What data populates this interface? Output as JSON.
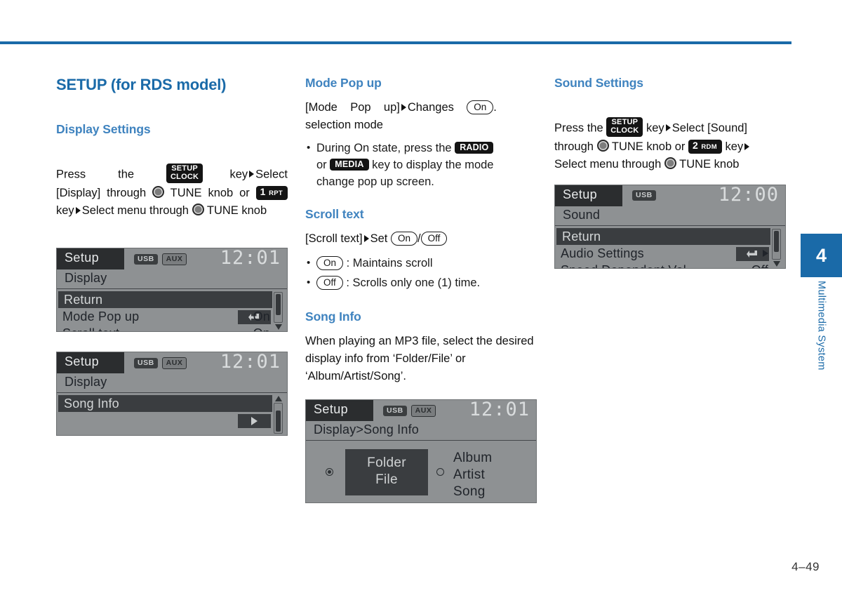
{
  "page": {
    "number": "4–49",
    "chapter_number": "4",
    "chapter_label": "Multimedia System",
    "accent_color": "#1a6aa8",
    "heading_color": "#3f83bf"
  },
  "col1": {
    "main_title": "SETUP (for RDS model)",
    "section_title": "Display Settings",
    "instruction": {
      "t1": "Press",
      "t2": "the",
      "key_setup_line1": "SETUP",
      "key_setup_line2": "CLOCK",
      "t3": "key",
      "t4": "Select",
      "t5": "[Display]",
      "t6": "through",
      "t7": "TUNE",
      "t8": "knob",
      "t9": "or",
      "key_num": "1",
      "key_num_sub": "RPT",
      "t10": "key",
      "t11": "Select",
      "t12": "menu",
      "t13": "through",
      "t14": "TUNE knob"
    },
    "lcd1": {
      "title": "Setup",
      "badges": [
        "USB",
        "AUX"
      ],
      "clock": "12:01",
      "path": "Display",
      "rows": [
        {
          "label": "Return",
          "value": "",
          "selected": true,
          "icon": "return-arrow"
        },
        {
          "label": "Mode Pop up",
          "value": "On",
          "selected": false,
          "icon": ""
        },
        {
          "label": "Scroll text",
          "value": "On",
          "selected": false,
          "icon": ""
        }
      ]
    },
    "lcd2": {
      "title": "Setup",
      "badges": [
        "USB",
        "AUX"
      ],
      "clock": "12:01",
      "path": "Display",
      "rows": [
        {
          "label": "Song Info",
          "value": "",
          "selected": true,
          "icon": "chevron-right"
        }
      ]
    }
  },
  "col2": {
    "mode_popup": {
      "title": "Mode Pop up",
      "line1_a": "[Mode",
      "line1_b": "Pop",
      "line1_c": "up]",
      "line1_d": "Changes",
      "pill_on": "On",
      "line1_e": ".",
      "line2": "selection mode",
      "bullet1_a": "During On state, press the",
      "key_radio": "RADIO",
      "bullet1_b": "or",
      "key_media": "MEDIA",
      "bullet1_c": "key to display the mode",
      "bullet1_d": "change pop up screen."
    },
    "scroll_text": {
      "title": "Scroll text",
      "lead_a": "[Scroll text]",
      "lead_b": "Set",
      "pill_on": "On",
      "slash": "/",
      "pill_off": "Off",
      "item1_pill": "On",
      "item1_text": ": Maintains scroll",
      "item2_pill": "Off",
      "item2_text": ": Scrolls only one (1) time."
    },
    "song_info": {
      "title": "Song Info",
      "body": "When playing an MP3 file, select the desired display info from ‘Folder/File’ or ‘Album/Artist/Song’.",
      "lcd": {
        "title": "Setup",
        "badges": [
          "USB",
          "AUX"
        ],
        "clock": "12:01",
        "path": "Display>Song Info",
        "option_left_line1": "Folder",
        "option_left_line2": "File",
        "option_right_line1": "Album",
        "option_right_line2": "Artist",
        "option_right_line3": "Song",
        "selected": "left"
      }
    }
  },
  "col3": {
    "title": "Sound Settings",
    "instruction": {
      "t1": "Press the",
      "key_setup_line1": "SETUP",
      "key_setup_line2": "CLOCK",
      "t2": "key",
      "t3": "Select [Sound]",
      "t4": "through",
      "t5": "TUNE knob or",
      "key_num": "2",
      "key_num_sub": "RDM",
      "t6": "key",
      "t7": "Select menu through",
      "t8": "TUNE knob"
    },
    "lcd": {
      "title": "Setup",
      "badges": [
        "USB"
      ],
      "clock": "12:00",
      "path": "Sound",
      "rows": [
        {
          "label": "Return",
          "value": "",
          "selected": true,
          "icon": "return-arrow"
        },
        {
          "label": "Audio Settings",
          "value": "",
          "selected": false,
          "icon": "chevron-right"
        },
        {
          "label": "Speed Dependent Vol.",
          "value": "Off",
          "selected": false,
          "icon": ""
        }
      ]
    }
  }
}
